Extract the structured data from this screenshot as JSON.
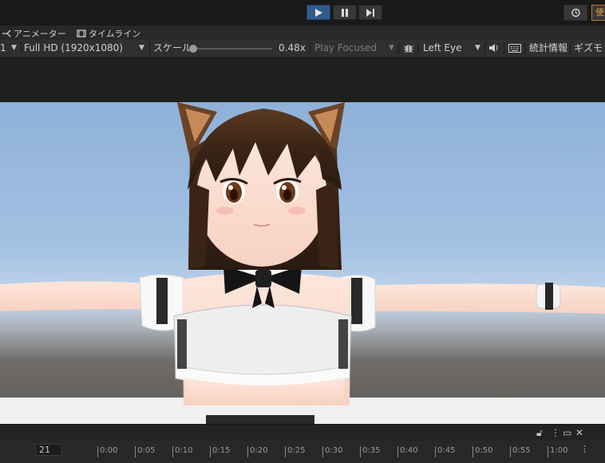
{
  "play_controls": {
    "play": "play-icon",
    "pause": "pause-icon",
    "step": "step-icon",
    "highlight_color": "#e02020"
  },
  "top_right": {
    "history": "history-icon",
    "clipped_label": "使"
  },
  "tabs": [
    {
      "label": "アニメーター",
      "icon": "animator-icon"
    },
    {
      "label": "タイムライン",
      "icon": "timeline-icon"
    }
  ],
  "game_toolbar": {
    "display_suffix": "1",
    "resolution": "Full HD (1920x1080)",
    "scale_label": "スケール",
    "scale_value": "0.48x",
    "scale_fraction": 0.0,
    "play_mode": "Play Focused",
    "eye": "Left Eye",
    "stats_label": "統計情報",
    "gizmos_label": "ギズモ"
  },
  "timeline": {
    "frame": "21",
    "ticks": [
      "0:00",
      "0:05",
      "0:10",
      "0:15",
      "0:20",
      "0:25",
      "0:30",
      "0:35",
      "0:40",
      "0:45",
      "0:50",
      "0:55",
      "1:00"
    ]
  }
}
